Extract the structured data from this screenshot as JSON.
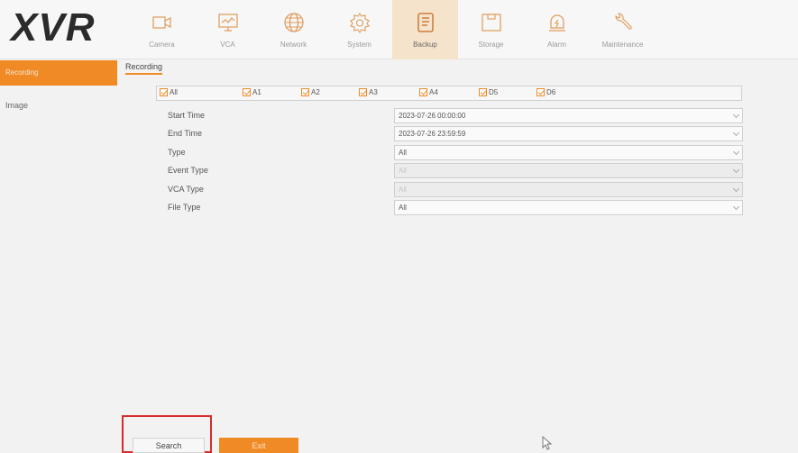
{
  "header": {
    "logo": "XVR"
  },
  "nav": [
    {
      "label": "Camera",
      "icon": "camera-icon"
    },
    {
      "label": "VCA",
      "icon": "vca-icon"
    },
    {
      "label": "Network",
      "icon": "network-globe-icon"
    },
    {
      "label": "System",
      "icon": "gear-icon"
    },
    {
      "label": "Backup",
      "icon": "backup-icon",
      "active": true
    },
    {
      "label": "Storage",
      "icon": "storage-icon"
    },
    {
      "label": "Alarm",
      "icon": "alarm-icon"
    },
    {
      "label": "Maintenance",
      "icon": "wrench-icon"
    }
  ],
  "sidebar": {
    "items": [
      {
        "label": "Recording",
        "active": true
      },
      {
        "label": "Image"
      }
    ]
  },
  "tab": {
    "label": "Recording"
  },
  "channels": [
    "All",
    "A1",
    "A2",
    "A3",
    "A4",
    "D5",
    "D6"
  ],
  "form": {
    "start_time": {
      "label": "Start Time",
      "value": "2023-07-26 00:00:00"
    },
    "end_time": {
      "label": "End Time",
      "value": "2023-07-26 23:59:59"
    },
    "type": {
      "label": "Type",
      "value": "All"
    },
    "event_type": {
      "label": "Event Type",
      "value": "All"
    },
    "vca_type": {
      "label": "VCA Type",
      "value": "All"
    },
    "file_type": {
      "label": "File Type",
      "value": "All"
    }
  },
  "buttons": {
    "search": "Search",
    "exit": "Exit"
  },
  "colors": {
    "accent": "#f08a24",
    "highlight": "#d92b2b"
  }
}
